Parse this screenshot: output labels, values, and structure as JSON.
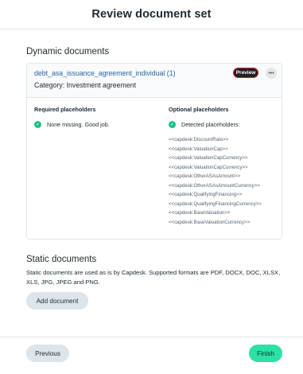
{
  "header": {
    "title": "Review document set"
  },
  "dynamic": {
    "title": "Dynamic documents",
    "document": {
      "name": "debt_asa_issuance_agreement_individual (1)",
      "category": "Category: Investment agreement",
      "preview_label": "Preview",
      "more_label": "•••"
    },
    "required": {
      "heading": "Required placeholders",
      "status": "None missing. Good job."
    },
    "optional": {
      "heading": "Optional placeholders",
      "status": "Detected placeholders:",
      "placeholders": [
        "<<capdesk:DiscountRate>>",
        "<<capdesk:ValuationCap>>",
        "<<capdesk:ValuationCapCurrency>>",
        "<<capdesk:ValuationCapCurrency>>",
        "<<capdesk:OtherASAsAmount>>",
        "<<capdesk:OtherASAsAmountCurrency>>",
        "<<capdesk:QualifyingFinancing>>",
        "<<capdesk:QualifyingFinancingCurrency>>",
        "<<capdesk:BaseValuation>>",
        "<<capdesk:BaseValuationCurrency>>"
      ]
    }
  },
  "static": {
    "title": "Static documents",
    "description": "Static documents are used as is by Capdesk. Supported formats are PDF, DOCX, DOC, XLSX, XLS, JPG, JPEG and PNG.",
    "add_label": "Add document"
  },
  "footer": {
    "previous_label": "Previous",
    "finish_label": "Finish"
  },
  "colors": {
    "link": "#2b63a7",
    "success": "#1fbf8c",
    "primary_button": "#2de0a6",
    "secondary_button": "#dde5eb",
    "preview_button": "#1e2125",
    "preview_outline": "#d9202b"
  },
  "icons": {
    "check": "check-circle-icon",
    "more": "more-horizontal-icon"
  }
}
